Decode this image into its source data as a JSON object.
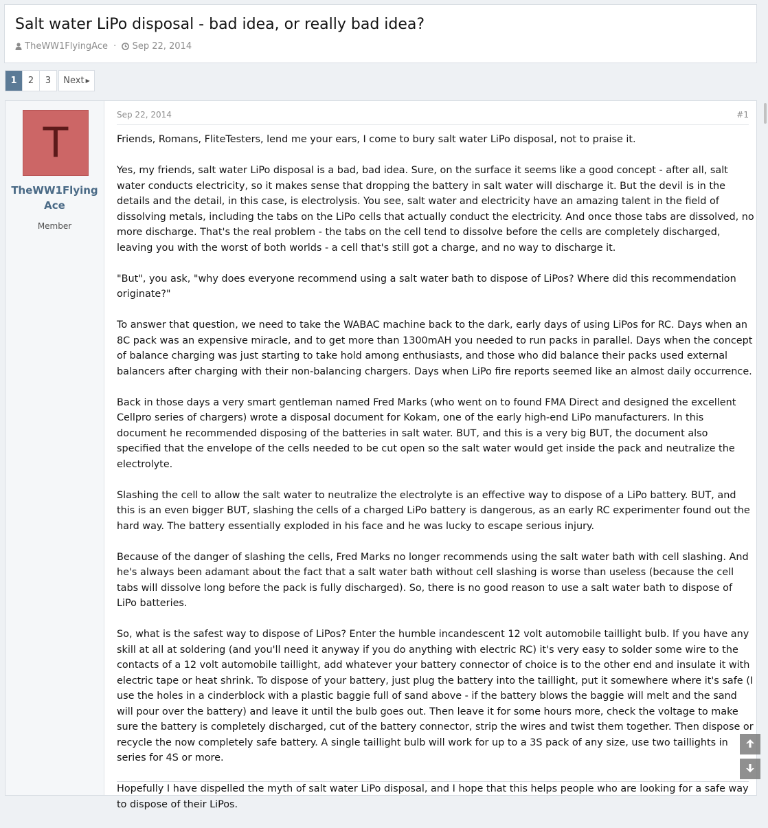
{
  "thread": {
    "title": "Salt water LiPo disposal - bad idea, or really bad idea?",
    "author": "TheWW1FlyingAce",
    "separator": "·",
    "date": "Sep 22, 2014"
  },
  "pagination": {
    "pages": [
      "1",
      "2",
      "3"
    ],
    "current": "1",
    "next_label": "Next"
  },
  "post": {
    "username_line1": "TheWW1Flying",
    "username_line2": "Ace",
    "avatar_letter": "T",
    "user_title": "Member",
    "date": "Sep 22, 2014",
    "number": "#1",
    "paragraphs": [
      "Friends, Romans, FliteTesters, lend me your ears, I come to bury salt water LiPo disposal, not to praise it.",
      "Yes, my friends, salt water LiPo disposal is a bad, bad idea. Sure, on the surface it seems like a good concept - after all, salt water conducts electricity, so it makes sense that dropping the battery in salt water will discharge it. But the devil is in the details and the detail, in this case, is electrolysis. You see, salt water and electricity have an amazing talent in the field of dissolving metals, including the tabs on the LiPo cells that actually conduct the electricity. And once those tabs are dissolved, no more discharge. That's the real problem - the tabs on the cell tend to dissolve before the cells are completely discharged, leaving you with the worst of both worlds - a cell that's still got a charge, and no way to discharge it.",
      "\"But\", you ask, \"why does everyone recommend using a salt water bath to dispose of LiPos? Where did this recommendation originate?\"",
      "To answer that question, we need to take the WABAC machine back to the dark, early days of using LiPos for RC. Days when an 8C pack was an expensive miracle, and to get more than 1300mAH you needed to run packs in parallel. Days when the concept of balance charging was just starting to take hold among enthusiasts, and those who did balance their packs used external balancers after charging with their non-balancing chargers. Days when LiPo fire reports seemed like an almost daily occurrence.",
      "Back in those days a very smart gentleman named Fred Marks (who went on to found FMA Direct and designed the excellent Cellpro series of chargers) wrote a disposal document for Kokam, one of the early high-end LiPo manufacturers. In this document he recommended disposing of the batteries in salt water. BUT, and this is a very big BUT, the document also specified that the envelope of the cells needed to be cut open so the salt water would get inside the pack and neutralize the electrolyte.",
      "Slashing the cell to allow the salt water to neutralize the electrolyte is an effective way to dispose of a LiPo battery. BUT, and this is an even bigger BUT, slashing the cells of a charged LiPo battery is dangerous, as an early RC experimenter found out the hard way. The battery essentially exploded in his face and he was lucky to escape serious injury.",
      "Because of the danger of slashing the cells, Fred Marks no longer recommends using the salt water bath with cell slashing. And he's always been adamant about the fact that a salt water bath without cell slashing is worse than useless (because the cell tabs will dissolve long before the pack is fully discharged). So, there is no good reason to use a salt water bath to dispose of LiPo batteries.",
      "So, what is the safest way to dispose of LiPos? Enter the humble incandescent 12 volt automobile taillight bulb. If you have any skill at all at soldering (and you'll need it anyway if you do anything with electric RC) it's very easy to solder some wire to the contacts of a 12 volt automobile taillight, add whatever your battery connector of choice is to the other end and insulate it with electric tape or heat shrink. To dispose of your battery, just plug the battery into the taillight, put it somewhere where it's safe (I use the holes in a cinderblock with a plastic baggie full of sand above - if the battery blows the baggie will melt and the sand will pour over the battery) and leave it until the bulb goes out. Then leave it for some hours more, check the voltage to make sure the battery is completely discharged, cut of the battery connector, strip the wires and twist them together. Then dispose or recycle the now completely safe battery. A single taillight bulb will work for up to a 3S pack of any size, use two taillights in series for 4S or more.",
      "Hopefully I have dispelled the myth of salt water LiPo disposal, and I hope that this helps people who are looking for a safe way to dispose of their LiPos."
    ]
  },
  "icons": {
    "author": "user-icon",
    "date": "clock-icon",
    "scroll_up": "arrow-up-icon",
    "scroll_down": "arrow-down-icon"
  },
  "colors": {
    "current_page": "#5b7a96",
    "username": "#4a6a86",
    "avatar_bg": "#cc6666"
  }
}
